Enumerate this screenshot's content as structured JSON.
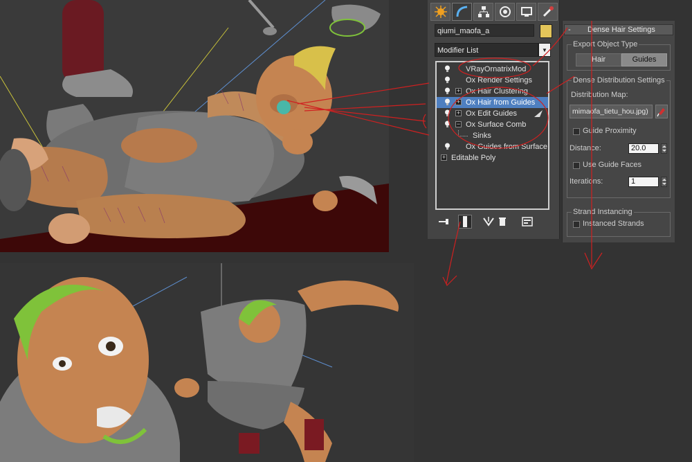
{
  "command_panel": {
    "tabs": [
      "create-icon",
      "modify-icon",
      "hierarchy-icon",
      "motion-icon",
      "display-icon",
      "utilities-icon"
    ],
    "object_name": "qiumi_maofa_a",
    "object_color": "#e4c65a",
    "modifier_list_label": "Modifier List",
    "stack": [
      {
        "label": "VRayOrnatrixMod",
        "selected": false
      },
      {
        "label": "Ox Render Settings",
        "selected": false
      },
      {
        "label": "Ox Hair Clustering",
        "selected": false
      },
      {
        "label": "Ox Hair from Guides",
        "selected": true
      },
      {
        "label": "Ox Edit Guides",
        "selected": false
      },
      {
        "label": "Ox Surface Comb",
        "selected": false
      },
      {
        "label": "Sinks",
        "selected": false
      },
      {
        "label": "Ox Guides from Surface",
        "selected": false
      },
      {
        "label": "Editable Poly",
        "selected": false
      }
    ],
    "stack_tools": [
      "pin-stack-icon",
      "show-end-result-icon",
      "make-unique-icon",
      "remove-modifier-icon",
      "configure-sets-icon"
    ]
  },
  "rollout": {
    "collapse_symbol": "-",
    "title": "Dense Hair Settings",
    "export_group": {
      "title": "Export Object Type",
      "hair_label": "Hair",
      "guides_label": "Guides",
      "active": "Guides"
    },
    "distribution_group": {
      "title": "Dense Distribution Settings",
      "map_label": "Distribution Map:",
      "map_value": "mimaofa_tietu_hou.jpg)",
      "guide_proximity_label": "Guide Proximity",
      "guide_proximity_checked": false,
      "distance_label": "Distance:",
      "distance_value": "20.0",
      "use_guide_faces_label": "Use Guide Faces",
      "use_guide_faces_checked": false,
      "iterations_label": "Iterations:",
      "iterations_value": "1"
    },
    "instancing_group": {
      "title": "Strand Instancing",
      "instanced_strands_label": "Instanced Strands",
      "instanced_strands_checked": false
    }
  },
  "colors": {
    "viewport_bg": "#3a3a3a",
    "hair_yellow": "#d8c04a",
    "hair_green": "#7fc23a",
    "skin": "#c98a5a",
    "annotation_red": "#d02020",
    "selection_blue": "#4e7fc0"
  }
}
